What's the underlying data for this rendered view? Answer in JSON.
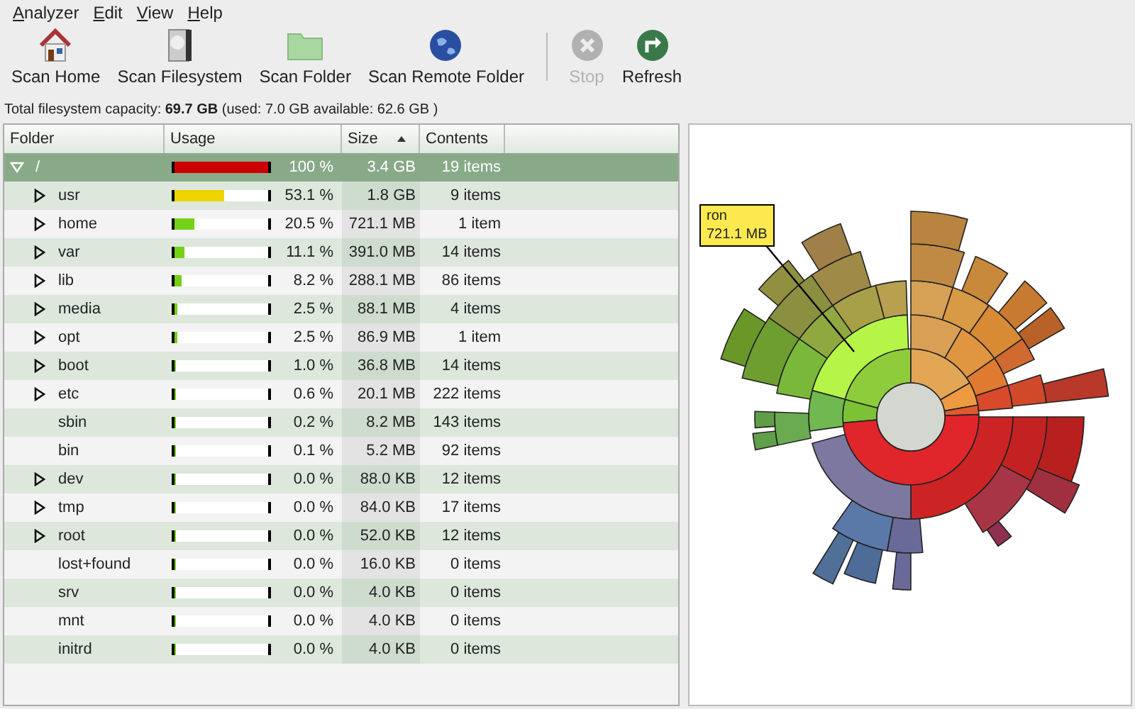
{
  "menu": [
    "Analyzer",
    "Edit",
    "View",
    "Help"
  ],
  "toolbar": [
    {
      "label": "Scan Home",
      "disabled": false
    },
    {
      "label": "Scan Filesystem",
      "disabled": false
    },
    {
      "label": "Scan Folder",
      "disabled": false
    },
    {
      "label": "Scan Remote Folder",
      "disabled": false
    },
    {
      "label": "Stop",
      "disabled": true
    },
    {
      "label": "Refresh",
      "disabled": false
    }
  ],
  "capacity": "Total filesystem capacity: **69.7 GB** (used: 7.0 GB available: 62.6 GB )",
  "table": {
    "columns": [
      {
        "label": "Folder",
        "sorted": false
      },
      {
        "label": "Usage",
        "sorted": false
      },
      {
        "label": "Size",
        "sorted": true
      },
      {
        "label": "Contents",
        "sorted": false
      }
    ],
    "rows": [
      {
        "name": "/",
        "level": 1.0,
        "color": "#cc0000",
        "percent": "100 %",
        "size": "3.4 GB",
        "contents": "19 items",
        "selected": true,
        "expandable": true,
        "expanded": true,
        "children": [
          {
            "name": "usr",
            "level": 0.531,
            "color": "#edd400",
            "percent": "53.1 %",
            "size": "1.8 GB",
            "contents": "9 items",
            "selected": false,
            "expandable": true
          },
          {
            "name": "home",
            "level": 0.205,
            "color": "#73d216",
            "percent": "20.5 %",
            "size": "721.1 MB",
            "contents": "1 item",
            "selected": false,
            "expandable": true
          },
          {
            "name": "var",
            "level": 0.111,
            "color": "#73d216",
            "percent": "11.1 %",
            "size": "391.0 MB",
            "contents": "14 items",
            "selected": false,
            "expandable": true
          },
          {
            "name": "lib",
            "level": 0.082,
            "color": "#73d216",
            "percent": "8.2 %",
            "size": "288.1 MB",
            "contents": "86 items",
            "selected": false,
            "expandable": true
          },
          {
            "name": "media",
            "level": 0.025,
            "color": "#73d216",
            "percent": "2.5 %",
            "size": "88.1 MB",
            "contents": "4 items",
            "selected": false,
            "expandable": true
          },
          {
            "name": "opt",
            "level": 0.025,
            "color": "#73d216",
            "percent": "2.5 %",
            "size": "86.9 MB",
            "contents": "1 item",
            "selected": false,
            "expandable": true
          },
          {
            "name": "boot",
            "level": 0.01,
            "color": "#73d216",
            "percent": "1.0 %",
            "size": "36.8 MB",
            "contents": "14 items",
            "selected": false,
            "expandable": true
          },
          {
            "name": "etc",
            "level": 0.006,
            "color": "#73d216",
            "percent": "0.6 %",
            "size": "20.1 MB",
            "contents": "222 items",
            "selected": false,
            "expandable": true
          },
          {
            "name": "sbin",
            "level": 0.002,
            "color": "#73d216",
            "percent": "0.2 %",
            "size": "8.2 MB",
            "contents": "143 items",
            "selected": false,
            "expandable": false
          },
          {
            "name": "bin",
            "level": 0.001,
            "color": "#73d216",
            "percent": "0.1 %",
            "size": "5.2 MB",
            "contents": "92 items",
            "selected": false,
            "expandable": false
          },
          {
            "name": "dev",
            "level": 0.0,
            "color": "#73d216",
            "percent": "0.0 %",
            "size": "88.0 KB",
            "contents": "12 items",
            "selected": false,
            "expandable": true
          },
          {
            "name": "tmp",
            "level": 0.0,
            "color": "#73d216",
            "percent": "0.0 %",
            "size": "84.0 KB",
            "contents": "17 items",
            "selected": false,
            "expandable": true
          },
          {
            "name": "root",
            "level": 0.0,
            "color": "#73d216",
            "percent": "0.0 %",
            "size": "52.0 KB",
            "contents": "12 items",
            "selected": false,
            "expandable": true
          },
          {
            "name": "lost+found",
            "level": 0.0,
            "color": "#73d216",
            "percent": "0.0 %",
            "size": "16.0 KB",
            "contents": "0 items",
            "selected": false,
            "expandable": false
          },
          {
            "name": "srv",
            "level": 0.0,
            "color": "#73d216",
            "percent": "0.0 %",
            "size": "4.0 KB",
            "contents": "0 items",
            "selected": false,
            "expandable": false
          },
          {
            "name": "mnt",
            "level": 0.0,
            "color": "#73d216",
            "percent": "0.0 %",
            "size": "4.0 KB",
            "contents": "0 items",
            "selected": false,
            "expandable": false
          },
          {
            "name": "initrd",
            "level": 0.0,
            "color": "#73d216",
            "percent": "0.0 %",
            "size": "4.0 KB",
            "contents": "0 items",
            "selected": false,
            "expandable": false
          }
        ]
      }
    ]
  },
  "tooltip": {
    "name": "ron",
    "size": "721.1 MB"
  }
}
